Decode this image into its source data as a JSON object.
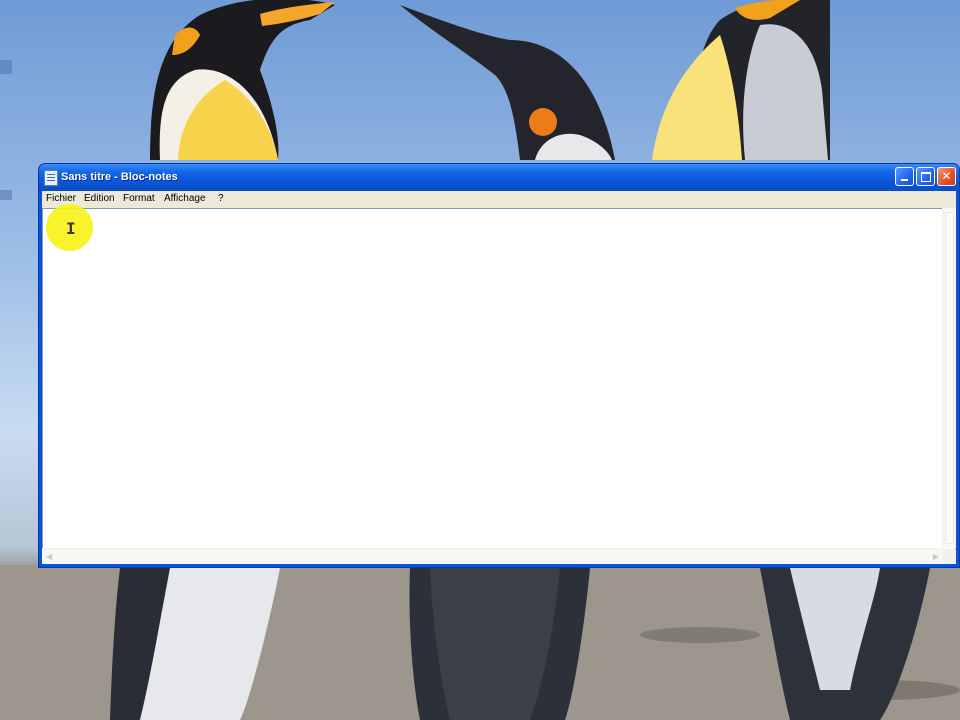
{
  "window": {
    "title": "Sans titre - Bloc-notes"
  },
  "menu": {
    "items": [
      "Fichier",
      "Edition",
      "Format",
      "Affichage",
      "?"
    ]
  },
  "editor": {
    "content": ""
  },
  "icons": {
    "app": "notepad-icon",
    "minimize": "minimize-icon",
    "maximize": "maximize-icon",
    "close": "close-icon",
    "cursor": "text-cursor-icon"
  },
  "colors": {
    "titlebar": "#0a55d6",
    "menubar": "#ece9d8",
    "cursor_highlight": "#f7f21a"
  }
}
